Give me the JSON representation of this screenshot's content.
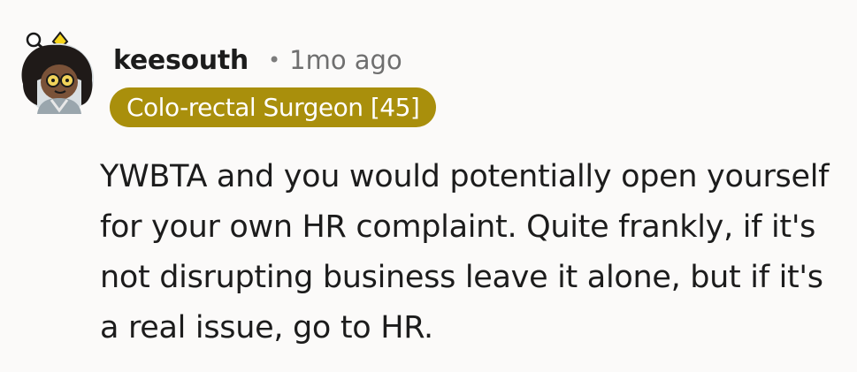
{
  "comment": {
    "username": "keesouth",
    "separator": "•",
    "timestamp": "1mo ago",
    "flair": "Colo-rectal Surgeon [45]",
    "body": "YWBTA and you would potentially open yourself for your own HR complaint. Quite frankly, if it's not disrupting business leave it alone, but if it's a real issue, go to HR."
  },
  "colors": {
    "flair_background": "#a98f0c",
    "page_background": "#fbfaf9",
    "text": "#1c1c1c",
    "muted": "#6f6f6f"
  }
}
